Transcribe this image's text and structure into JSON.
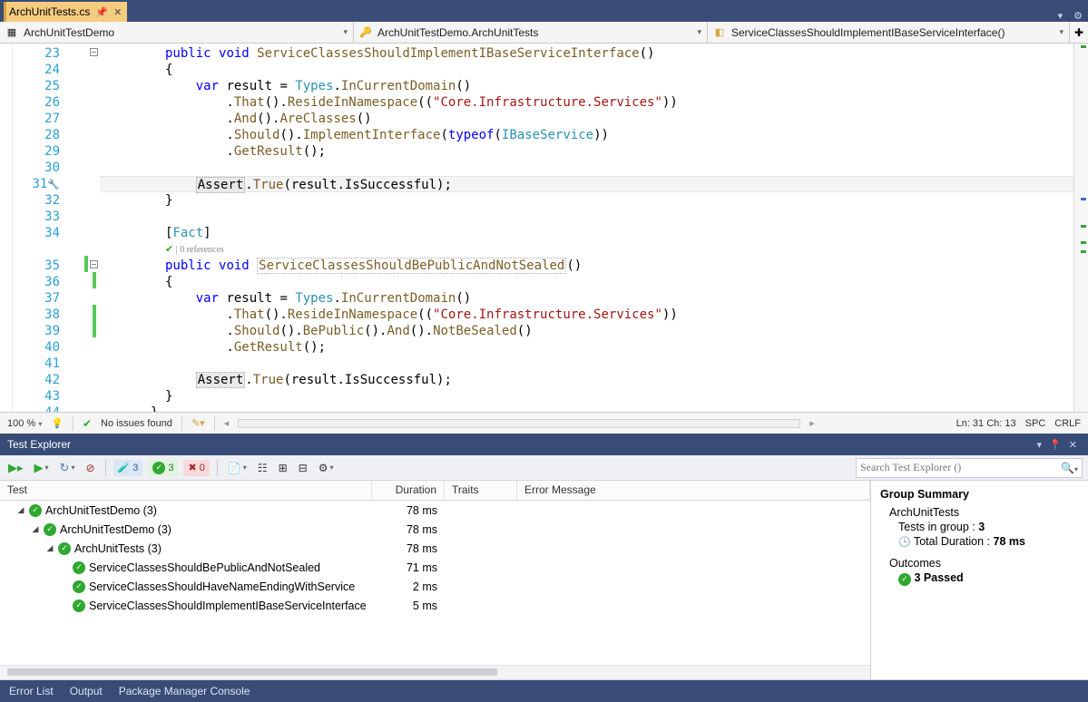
{
  "tabs": {
    "active": {
      "name": "ArchUnitTests.cs",
      "pinned": true
    }
  },
  "nav": {
    "project": "ArchUnitTestDemo",
    "class": "ArchUnitTestDemo.ArchUnitTests",
    "member": "ServiceClassesShouldImplementIBaseServiceInterface()"
  },
  "editor": {
    "first_line": 23,
    "lightbulb_line": 31,
    "collapse_lines": [
      23,
      35
    ],
    "greenbar_lines": [
      35,
      36,
      38,
      39
    ],
    "codelens": {
      "before_line": 35,
      "text": "| 0 references"
    },
    "cursor": {
      "ln": 31,
      "ch": 13
    },
    "code": {
      "23": [
        [
          "kw",
          "public"
        ],
        [
          "",
          " "
        ],
        [
          "kw",
          "void"
        ],
        [
          "",
          " "
        ],
        [
          "fn",
          "ServiceClassesShouldImplementIBaseServiceInterface"
        ],
        [
          "",
          "()"
        ]
      ],
      "24": [
        [
          "",
          "{"
        ]
      ],
      "25": [
        [
          "",
          "    "
        ],
        [
          "kw",
          "var"
        ],
        [
          "",
          " result = "
        ],
        [
          "type",
          "Types"
        ],
        [
          "",
          "."
        ],
        [
          "fn",
          "InCurrentDomain"
        ],
        [
          "",
          "()"
        ]
      ],
      "26": [
        [
          "",
          "        ."
        ],
        [
          "fn",
          "That"
        ],
        [
          "",
          "()."
        ],
        [
          "fn",
          "ResideInNamespace"
        ],
        [
          "",
          "(("
        ],
        [
          "str",
          "\"Core.Infrastructure.Services\""
        ],
        [
          "",
          "))"
        ]
      ],
      "27": [
        [
          "",
          "        ."
        ],
        [
          "fn",
          "And"
        ],
        [
          "",
          "()."
        ],
        [
          "fn",
          "AreClasses"
        ],
        [
          "",
          "()"
        ]
      ],
      "28": [
        [
          "",
          "        ."
        ],
        [
          "fn",
          "Should"
        ],
        [
          "",
          "()."
        ],
        [
          "fn",
          "ImplementInterface"
        ],
        [
          "",
          "("
        ],
        [
          "kw",
          "typeof"
        ],
        [
          "",
          "("
        ],
        [
          "type",
          "IBaseService"
        ],
        [
          "",
          "))"
        ]
      ],
      "29": [
        [
          "",
          "        ."
        ],
        [
          "fn",
          "GetResult"
        ],
        [
          "",
          "();"
        ]
      ],
      "30": [
        [
          "",
          ""
        ]
      ],
      "31": [
        [
          "",
          "    "
        ],
        [
          "hl",
          "Assert"
        ],
        [
          "",
          "."
        ],
        [
          "fn",
          "True"
        ],
        [
          "",
          "(result.IsSuccessful);"
        ]
      ],
      "32": [
        [
          "",
          "}"
        ]
      ],
      "33": [
        [
          "",
          ""
        ]
      ],
      "34": [
        [
          "",
          "["
        ],
        [
          "attr",
          "Fact"
        ],
        [
          "",
          "]"
        ]
      ],
      "35": [
        [
          "kw",
          "public"
        ],
        [
          "",
          " "
        ],
        [
          "kw",
          "void"
        ],
        [
          "",
          " "
        ],
        [
          "do",
          "ServiceClassesShouldBePublicAndNotSealed"
        ],
        [
          "",
          "()"
        ]
      ],
      "36": [
        [
          "",
          "{"
        ]
      ],
      "37": [
        [
          "",
          "    "
        ],
        [
          "kw",
          "var"
        ],
        [
          "",
          " result = "
        ],
        [
          "type",
          "Types"
        ],
        [
          "",
          "."
        ],
        [
          "fn",
          "InCurrentDomain"
        ],
        [
          "",
          "()"
        ]
      ],
      "38": [
        [
          "",
          "        ."
        ],
        [
          "fn",
          "That"
        ],
        [
          "",
          "()."
        ],
        [
          "fn",
          "ResideInNamespace"
        ],
        [
          "",
          "(("
        ],
        [
          "str",
          "\"Core.Infrastructure.Services\""
        ],
        [
          "",
          "))"
        ]
      ],
      "39": [
        [
          "",
          "        ."
        ],
        [
          "fn",
          "Should"
        ],
        [
          "",
          "()."
        ],
        [
          "fn",
          "BePublic"
        ],
        [
          "",
          "()."
        ],
        [
          "fn",
          "And"
        ],
        [
          "",
          "()."
        ],
        [
          "fn",
          "NotBeSealed"
        ],
        [
          "",
          "()"
        ]
      ],
      "40": [
        [
          "",
          "        ."
        ],
        [
          "fn",
          "GetResult"
        ],
        [
          "",
          "();"
        ]
      ],
      "41": [
        [
          "",
          ""
        ]
      ],
      "42": [
        [
          "",
          "    "
        ],
        [
          "hl",
          "Assert"
        ],
        [
          "",
          "."
        ],
        [
          "fn",
          "True"
        ],
        [
          "",
          "(result.IsSuccessful);"
        ]
      ],
      "43": [
        [
          "",
          "}"
        ]
      ],
      "44": [
        [
          "",
          "}"
        ]
      ],
      "45": [
        [
          "",
          ""
        ]
      ]
    },
    "indent": {
      "23": 2,
      "24": 2,
      "25": 2,
      "26": 2,
      "27": 2,
      "28": 2,
      "29": 2,
      "30": 2,
      "31": 2,
      "32": 2,
      "33": 0,
      "34": 2,
      "35": 2,
      "36": 2,
      "37": 2,
      "38": 2,
      "39": 2,
      "40": 2,
      "41": 2,
      "42": 2,
      "43": 2,
      "44": 1,
      "45": 0
    }
  },
  "statusbar": {
    "zoom": "100 %",
    "issues": "No issues found",
    "pos": "Ln: 31    Ch: 13",
    "indent": "SPC",
    "eol": "CRLF"
  },
  "test_explorer": {
    "title": "Test Explorer",
    "counts": {
      "total": "3",
      "passed": "3",
      "failed": "0"
    },
    "search_placeholder": "Search Test Explorer ()",
    "columns": {
      "test": "Test",
      "duration": "Duration",
      "traits": "Traits",
      "error": "Error Message"
    },
    "tree": [
      {
        "level": 1,
        "expander": true,
        "name": "ArchUnitTestDemo  (3)",
        "duration": "78 ms"
      },
      {
        "level": 2,
        "expander": true,
        "name": "ArchUnitTestDemo  (3)",
        "duration": "78 ms"
      },
      {
        "level": 3,
        "expander": true,
        "name": "ArchUnitTests  (3)",
        "duration": "78 ms"
      },
      {
        "level": 4,
        "expander": false,
        "name": "ServiceClassesShouldBePublicAndNotSealed",
        "duration": "71 ms"
      },
      {
        "level": 4,
        "expander": false,
        "name": "ServiceClassesShouldHaveNameEndingWithService",
        "duration": "2 ms"
      },
      {
        "level": 4,
        "expander": false,
        "name": "ServiceClassesShouldImplementIBaseServiceInterface",
        "duration": "5 ms"
      }
    ],
    "summary": {
      "heading": "Group Summary",
      "group": "ArchUnitTests",
      "tests_in_group_label": "Tests in group :",
      "tests_in_group": "3",
      "total_duration_label": "Total Duration :",
      "total_duration": "78  ms",
      "outcomes_label": "Outcomes",
      "passed": "3 Passed"
    }
  },
  "bottom_tabs": [
    "Error List",
    "Output",
    "Package Manager Console"
  ]
}
